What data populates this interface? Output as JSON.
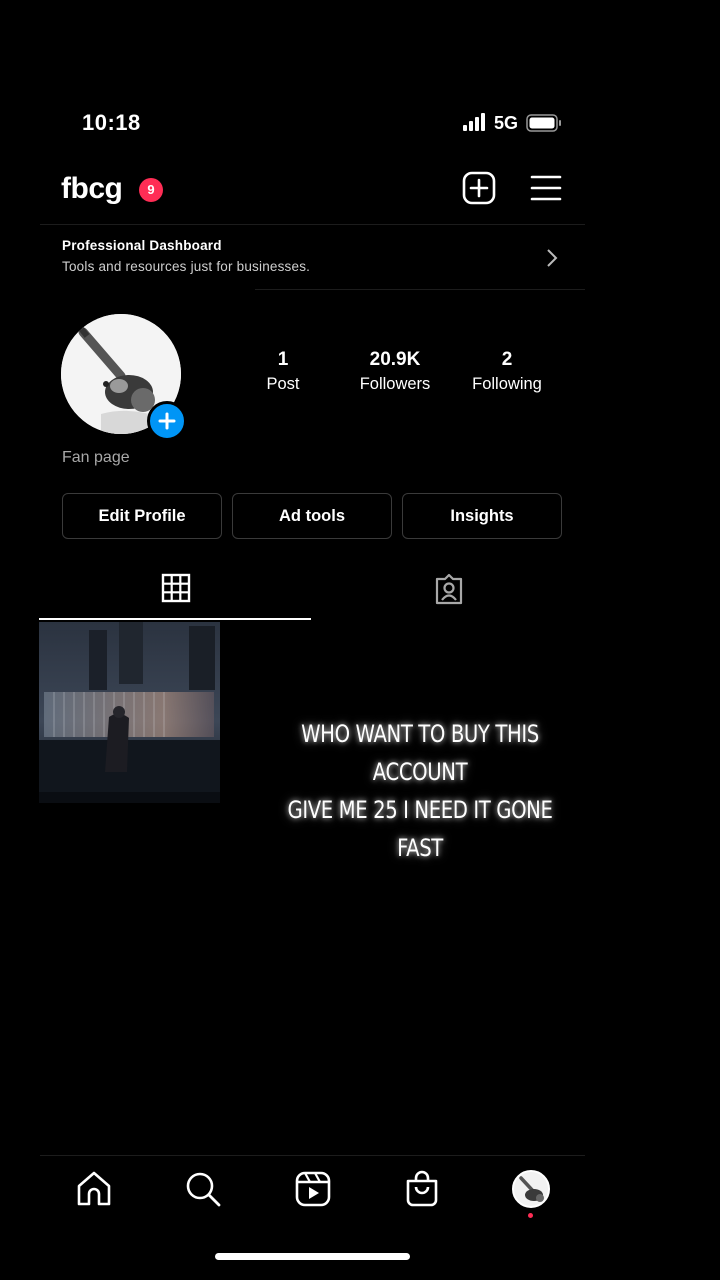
{
  "status_bar": {
    "time": "10:18",
    "network": "5G"
  },
  "header": {
    "username": "fbcg",
    "notification_count": "9"
  },
  "dashboard": {
    "title": "Professional Dashboard",
    "subtitle": "Tools and resources just for businesses."
  },
  "stats": [
    {
      "value": "1",
      "label": "Post"
    },
    {
      "value": "20.9K",
      "label": "Followers"
    },
    {
      "value": "2",
      "label": "Following"
    }
  ],
  "bio": {
    "category": "Fan page"
  },
  "buttons": {
    "edit_profile": "Edit Profile",
    "ad_tools": "Ad tools",
    "insights": "Insights"
  },
  "overlay_caption": {
    "line1": "WHO WANT TO BUY THIS  ACCOUNT",
    "line2": "GIVE ME 25 I NEED IT GONE FAST"
  },
  "icons": {
    "signal": "signal-bars-icon",
    "battery": "battery-icon",
    "create": "plus-square-icon",
    "menu": "hamburger-menu-icon",
    "chevron": "chevron-right-icon",
    "grid": "grid-icon",
    "tagged": "tagged-person-icon",
    "home": "home-icon",
    "search": "search-icon",
    "reels": "reels-icon",
    "shop": "shopping-bag-icon",
    "profile": "profile-avatar-icon"
  },
  "colors": {
    "notification_badge": "#ff2d55",
    "add_story": "#0095f6",
    "background": "#000000"
  }
}
